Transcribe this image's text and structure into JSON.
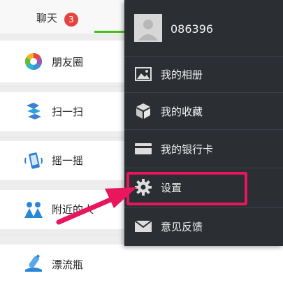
{
  "tabbar": {
    "chat_label": "聊天",
    "chat_badge": "3"
  },
  "discover": {
    "items": [
      {
        "label": "朋友圈",
        "icon": "moments-icon"
      },
      {
        "label": "扫一扫",
        "icon": "scan-icon"
      },
      {
        "label": "摇一摇",
        "icon": "shake-icon"
      },
      {
        "label": "附近的人",
        "icon": "people-nearby-icon"
      },
      {
        "label": "漂流瓶",
        "icon": "drift-bottle-icon"
      }
    ]
  },
  "menu": {
    "profile": {
      "name": "086396"
    },
    "items": [
      {
        "label": "我的相册",
        "icon": "album-icon"
      },
      {
        "label": "我的收藏",
        "icon": "favorites-icon"
      },
      {
        "label": "我的银行卡",
        "icon": "bank-card-icon"
      },
      {
        "label": "设置",
        "icon": "settings-icon"
      },
      {
        "label": "意见反馈",
        "icon": "feedback-icon"
      }
    ]
  },
  "colors": {
    "accent_green": "#45c01a",
    "badge_red": "#e64340",
    "highlight_pink": "#e8175d",
    "menu_bg": "#2b2e33"
  }
}
